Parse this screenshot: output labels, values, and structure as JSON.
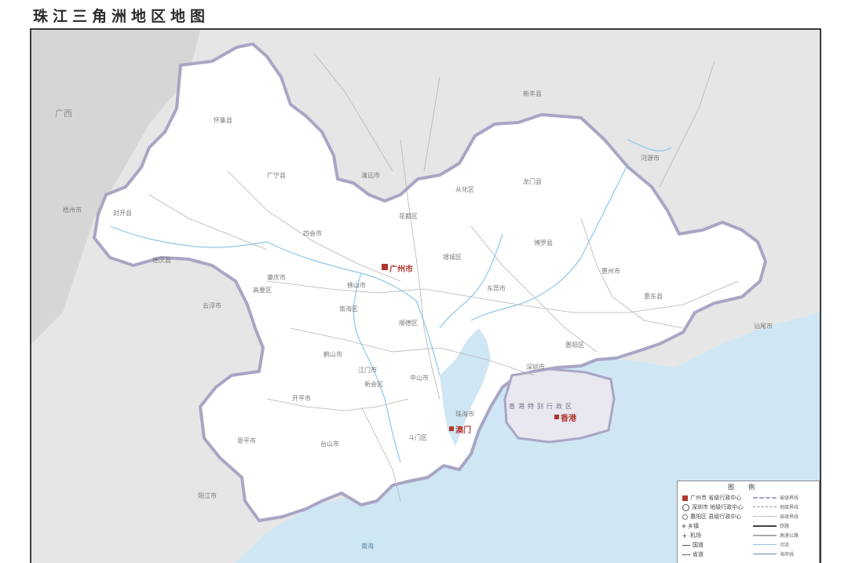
{
  "title": "珠江三角洲地区地图",
  "colors": {
    "land_outside": "#e4e4e4",
    "region": "#ffffff",
    "region_border": "#a8a6c4",
    "sea": "#cfe6f5",
    "water": "#b8dcf2",
    "road": "#9a9a9a",
    "capital": "#b0372c",
    "hk": "#e9e7ef"
  },
  "labels": {
    "guangzhou": "广州市",
    "macau": "澳门",
    "hongkong": "香港",
    "hk_region": "香港特别行政区",
    "qingyuan": "清远市",
    "foshan": "佛山市",
    "zhaoqing": "肇庆市",
    "jiangmen": "江门市",
    "zhongshan": "中山市",
    "zhuhai": "珠海市",
    "dongguan": "东莞市",
    "huizhou": "惠州市",
    "shenzhen": "深圳市",
    "huiyang": "惠阳区",
    "huidong": "惠东县",
    "boluo": "博罗县",
    "zengcheng": "增城区",
    "conghua": "从化区",
    "huadu": "花都区",
    "nanhai": "南海区",
    "shunde": "顺德区",
    "sihui": "四会市",
    "gaoyao": "高要区",
    "yunfu": "云浮市",
    "wuzhou": "梧州市",
    "yangjiang": "阳江市",
    "heyuan": "河源市",
    "shanwei": "汕尾市",
    "huaiji": "怀集县",
    "guangning": "广宁县",
    "fengkai": "封开县",
    "deqing": "德庆县",
    "kaiping": "开平市",
    "taishan": "台山市",
    "enping": "恩平市",
    "heshan": "鹤山市",
    "doumen": "斗门区",
    "xinhui": "新会区",
    "longmen": "龙门县",
    "xinfeng": "新丰县",
    "guangxi": "广西",
    "sea_south": "南海"
  },
  "legend": {
    "title": "图例",
    "rows": [
      "广州市 省级行政中心",
      "深圳市 地级行政中心",
      "惠阳区 县级行政中心",
      "乡镇",
      "机场",
      "国道",
      "省道"
    ],
    "lines": [
      "省级界线",
      "地级界线",
      "县级界线",
      "铁路",
      "高速公路",
      "河流",
      "海岸线"
    ]
  }
}
